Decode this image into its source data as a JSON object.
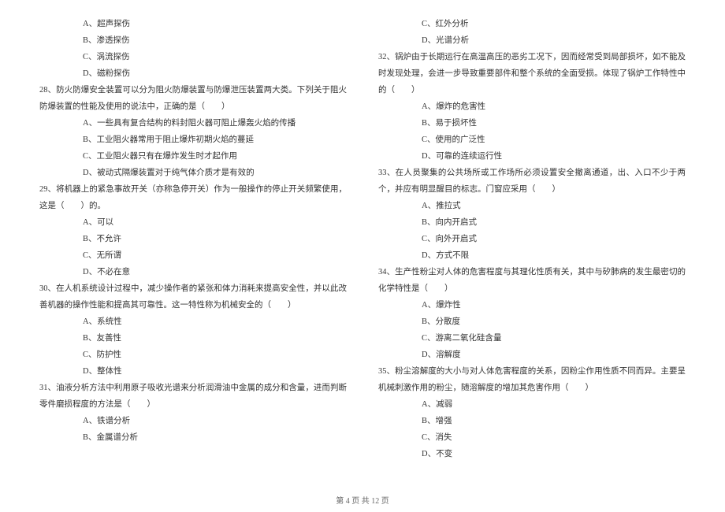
{
  "left_col": {
    "q27_options": [
      "A、超声探伤",
      "B、渗透探伤",
      "C、涡流探伤",
      "D、磁粉探伤"
    ],
    "q28_text": "28、防火防爆安全装置可以分为阻火防爆装置与防爆泄压装置两大类。下列关于阻火防爆装置的性能及使用的说法中，正确的是（　　）",
    "q28_options": [
      "A、一些具有复合结构的料封阻火器可阻止爆轰火焰的传播",
      "B、工业阻火器常用于阻止爆炸初期火焰的蔓延",
      "C、工业阻火器只有在爆炸发生时才起作用",
      "D、被动式隔爆装置对于纯气体介质才是有效的"
    ],
    "q29_text": "29、将机器上的紧急事故开关（亦称急停开关）作为一般操作的停止开关频繁使用，这是（　　）的。",
    "q29_options": [
      "A、可以",
      "B、不允许",
      "C、无所谓",
      "D、不必在意"
    ],
    "q30_text": "30、在人机系统设计过程中，减少操作者的紧张和体力消耗来提高安全性，并以此改善机器的操作性能和提高其可靠性。这一特性称为机械安全的（　　）",
    "q30_options": [
      "A、系统性",
      "B、友善性",
      "C、防护性",
      "D、整体性"
    ],
    "q31_text": "31、油液分析方法中利用原子吸收光谱来分析润滑油中金属的成分和含量，进而判断零件磨损程度的方法是（　　）",
    "q31_options": [
      "A、铁谱分析",
      "B、金属谱分析"
    ]
  },
  "right_col": {
    "q31_options_cont": [
      "C、红外分析",
      "D、光谱分析"
    ],
    "q32_text": "32、锅炉由于长期运行在高温高压的恶劣工况下，因而经常受到局部损坏，如不能及时发现处理，会进一步导致重要部件和整个系统的全面受损。体现了锅炉工作特性中的（　　）",
    "q32_options": [
      "A、爆炸的危害性",
      "B、易于损坏性",
      "C、使用的广泛性",
      "D、可靠的连续运行性"
    ],
    "q33_text": "33、在人员聚集的公共场所或工作场所必须设置安全撤离通道，出、入口不少于两个，并应有明显醒目的标志。门窗应采用（　　）",
    "q33_options": [
      "A、推拉式",
      "B、向内开启式",
      "C、向外开启式",
      "D、方式不限"
    ],
    "q34_text": "34、生产性粉尘对人体的危害程度与其理化性质有关，其中与矽肺病的发生最密切的化学特性是（　　）",
    "q34_options": [
      "A、爆炸性",
      "B、分散度",
      "C、游离二氧化硅含量",
      "D、溶解度"
    ],
    "q35_text": "35、粉尘溶解度的大小与对人体危害程度的关系，因粉尘作用性质不同而异。主要呈机械刺激作用的粉尘，随溶解度的增加其危害作用（　　）",
    "q35_options": [
      "A、减弱",
      "B、增强",
      "C、消失",
      "D、不变"
    ]
  },
  "footer": "第 4 页 共 12 页"
}
